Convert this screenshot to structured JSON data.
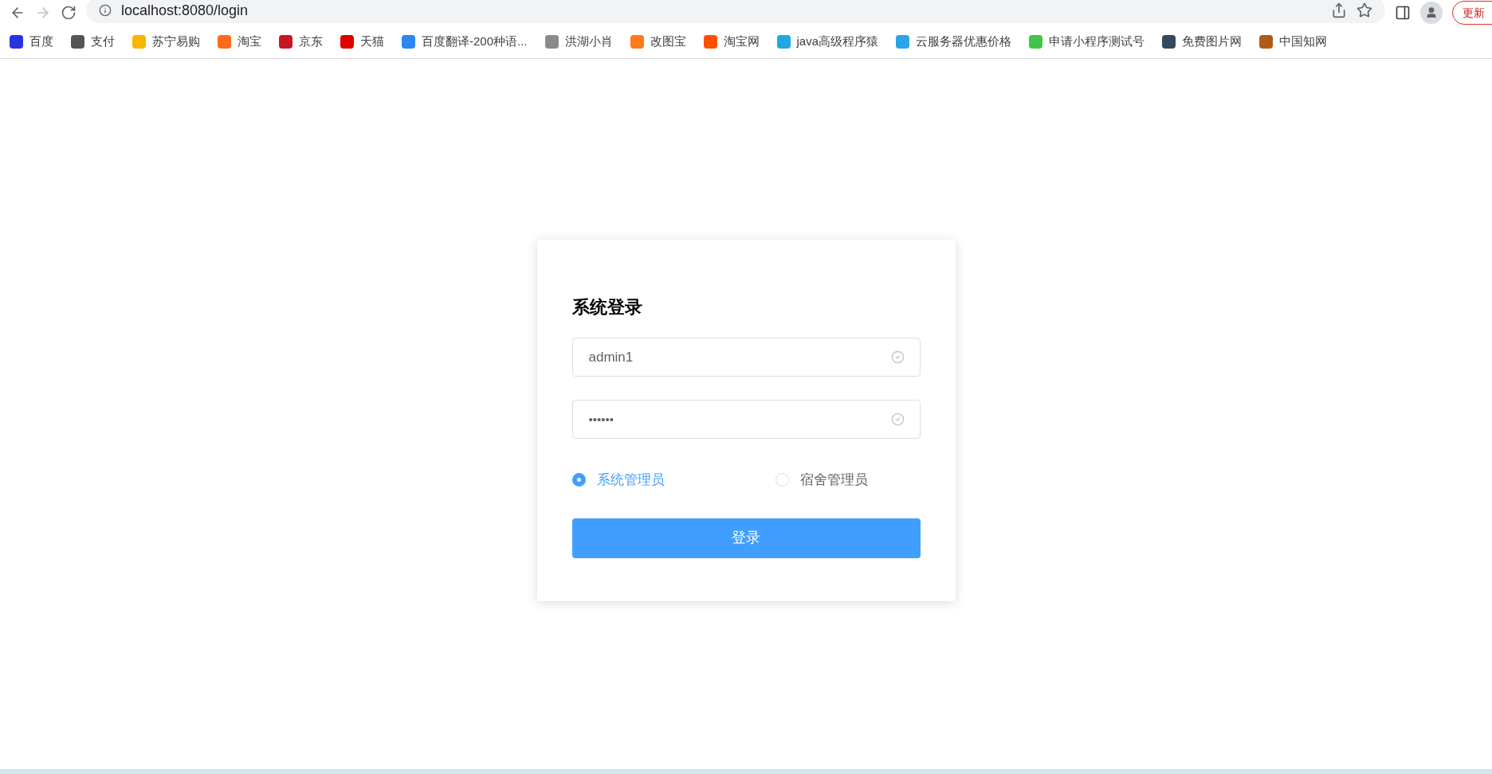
{
  "browser": {
    "url": "localhost:8080/login",
    "update_button": "更新"
  },
  "bookmarks": [
    {
      "label": "百度",
      "color": "#2932e1"
    },
    {
      "label": "支付",
      "color": "#555555"
    },
    {
      "label": "苏宁易购",
      "color": "#f7b500"
    },
    {
      "label": "淘宝",
      "color": "#ff6a1a"
    },
    {
      "label": "京东",
      "color": "#c81623"
    },
    {
      "label": "天猫",
      "color": "#e00000"
    },
    {
      "label": "百度翻译-200种语...",
      "color": "#2b86f0"
    },
    {
      "label": "洪湖小肖",
      "color": "#8a8a8a"
    },
    {
      "label": "改图宝",
      "color": "#ff7a1a"
    },
    {
      "label": "淘宝网",
      "color": "#ff5000"
    },
    {
      "label": "java高级程序猿",
      "color": "#1fa8e0"
    },
    {
      "label": "云服务器优惠价格",
      "color": "#2aa4e8"
    },
    {
      "label": "申请小程序测试号",
      "color": "#44c447"
    },
    {
      "label": "免费图片网",
      "color": "#34495e"
    },
    {
      "label": "中国知网",
      "color": "#b05a1a"
    }
  ],
  "login": {
    "title": "系统登录",
    "username": {
      "value": "admin1"
    },
    "password": {
      "value": "••••••"
    },
    "roles": [
      {
        "label": "系统管理员",
        "selected": true
      },
      {
        "label": "宿舍管理员",
        "selected": false
      }
    ],
    "submit": "登录"
  }
}
